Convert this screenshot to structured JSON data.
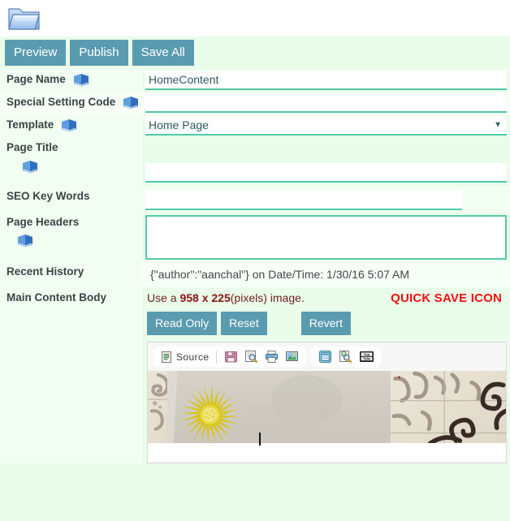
{
  "window": {
    "folder_icon": "open-folder-icon"
  },
  "toolbar": {
    "buttons": [
      {
        "label": "Preview",
        "name": "preview-button"
      },
      {
        "label": "Publish",
        "name": "publish-button"
      },
      {
        "label": "Save All",
        "name": "save-all-button"
      }
    ]
  },
  "form": {
    "rows": [
      {
        "label": "Page Name",
        "help_icon": "book-help-icon",
        "type": "text",
        "value": "HomeContent",
        "placeholder": ""
      },
      {
        "label": "Special Setting Code",
        "help_icon": "book-help-icon",
        "type": "text",
        "value": "",
        "placeholder": ""
      },
      {
        "label": "Template",
        "help_icon": "book-help-icon",
        "type": "select",
        "value": "Home Page",
        "options": [
          "Home Page"
        ],
        "arrow": "▼"
      },
      {
        "label": "Page Title",
        "help_icon": "book-help-icon",
        "type": "text",
        "value": "",
        "placeholder": ""
      },
      {
        "label": "SEO Key Words",
        "help_icon": "",
        "type": "text",
        "value": "",
        "placeholder": ""
      },
      {
        "label": "Page Headers",
        "help_icon": "book-help-icon",
        "type": "textarea",
        "value": "",
        "placeholder": ""
      },
      {
        "label": "Recent History",
        "help_icon": "",
        "type": "static",
        "value": "{\"author\":\"aanchal\"} on Date/Time: 1/30/16 5:07 AM"
      }
    ]
  },
  "main_content": {
    "label": "Main Content Body",
    "hint_prefix": "Use a ",
    "hint_dimensions": "958 x 225",
    "hint_suffix": "(pixels) image.",
    "quick_save_note": "QUICK SAVE ICON",
    "buttons": [
      {
        "label": "Read Only",
        "name": "read-only-button"
      },
      {
        "label": "Reset",
        "name": "reset-button"
      },
      {
        "label": "Revert",
        "name": "revert-button"
      }
    ]
  },
  "editor": {
    "source_label": "Source",
    "tools": [
      "source-icon",
      "save-icon",
      "preview-icon",
      "print-icon",
      "image-icon",
      "templates-icon",
      "find-replace-icon",
      "youtube-icon"
    ],
    "youtube_text_top": "You",
    "youtube_text_bottom": "Tube",
    "content_alt": "photo of a yellow flower printed on fabric over decorative tiles and wrought iron scrollwork"
  },
  "colors": {
    "page_background": "#eafdea",
    "label_background": "#f1fef1",
    "button": "#5b9bb0",
    "input_underline": "#4fc9a8",
    "hint_text": "#6e1f18",
    "quick_save_text": "#f70f0f"
  }
}
